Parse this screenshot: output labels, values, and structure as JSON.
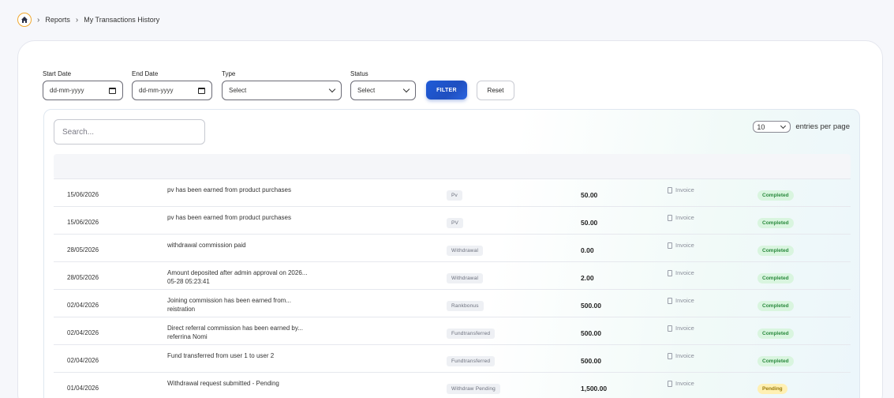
{
  "breadcrumb": {
    "items": [
      "Reports",
      "My Transactions History"
    ]
  },
  "filters": {
    "start_date": {
      "label": "Start Date",
      "placeholder": "dd-mm-yyyy"
    },
    "end_date": {
      "label": "End Date",
      "placeholder": "dd-mm-yyyy"
    },
    "type": {
      "label": "Type",
      "value": "Select"
    },
    "status": {
      "label": "Status",
      "value": "Select"
    },
    "filter_button": "FILTER",
    "reset_button": "Reset"
  },
  "table": {
    "search_placeholder": "Search...",
    "entries_value": "10",
    "entries_label": "entries per page",
    "rows": [
      {
        "date": "15/06/2026",
        "desc": "pv has been earned from product purchases",
        "type": "Pv",
        "amount": "50.00",
        "invoice": "Invoice",
        "status": "Completed",
        "status_kind": "completed"
      },
      {
        "date": "15/06/2026",
        "desc": "pv has been earned from product purchases",
        "type": "PV",
        "amount": "50.00",
        "invoice": "Invoice",
        "status": "Completed",
        "status_kind": "completed"
      },
      {
        "date": "28/05/2026",
        "desc": "withdrawal commission paid",
        "type": "Withdrawal",
        "amount": "0.00",
        "invoice": "Invoice",
        "status": "Completed",
        "status_kind": "completed"
      },
      {
        "date": "28/05/2026",
        "desc": "Amount deposited after admin approval on 2026...\n05-28 05:23:41",
        "type": "Withdrawal",
        "amount": "2.00",
        "invoice": "Invoice",
        "status": "Completed",
        "status_kind": "completed"
      },
      {
        "date": "02/04/2026",
        "desc": "Joining commission has been earned from...\nreistration",
        "type": "Rankbonus",
        "amount": "500.00",
        "invoice": "Invoice",
        "status": "Completed",
        "status_kind": "completed"
      },
      {
        "date": "02/04/2026",
        "desc": "Direct referral commission has been earned by...\nreferrina Nomi",
        "type": "Fundtransferred",
        "amount": "500.00",
        "invoice": "Invoice",
        "status": "Completed",
        "status_kind": "completed"
      },
      {
        "date": "02/04/2026",
        "desc": "Fund transferred from user 1 to user 2",
        "type": "Fundtransferred",
        "amount": "500.00",
        "invoice": "Invoice",
        "status": "Completed",
        "status_kind": "completed"
      },
      {
        "date": "01/04/2026",
        "desc": "Withdrawal request submitted - Pending",
        "type": "Withdraw Pending",
        "amount": "1,500.00",
        "invoice": "Invoice",
        "status": "Pending",
        "status_kind": "pending"
      }
    ]
  }
}
